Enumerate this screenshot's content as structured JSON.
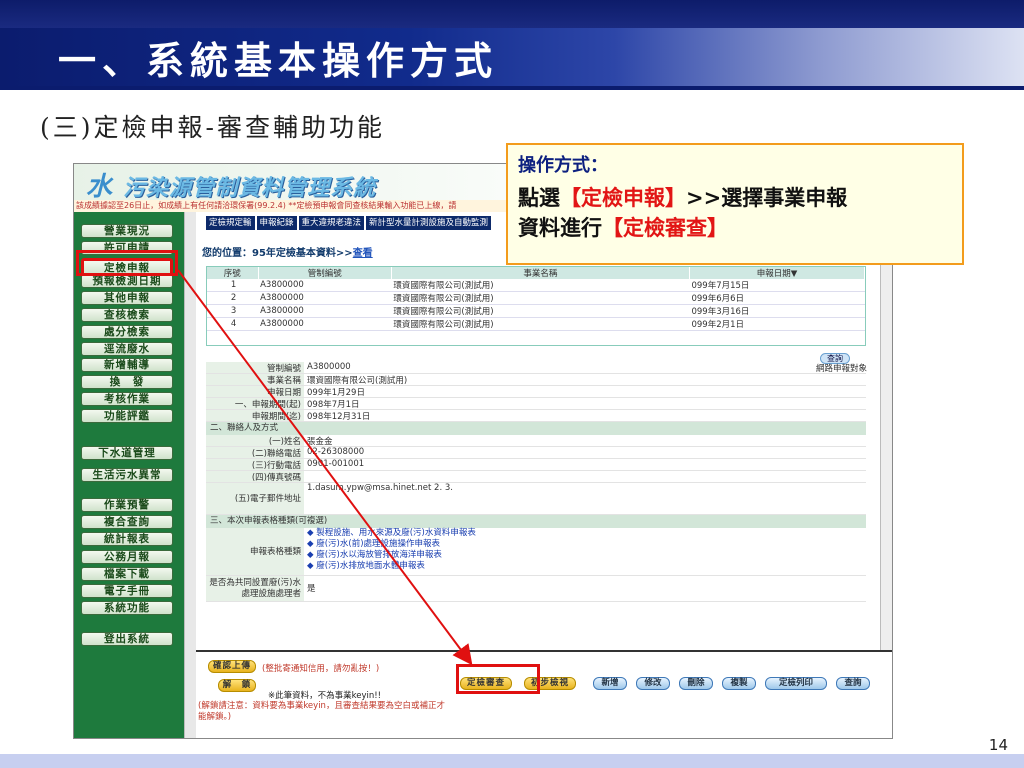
{
  "slide": {
    "title": "一、系統基本操作方式",
    "subtitle": "(三)定檢申報-審查輔助功能",
    "page_number": "14"
  },
  "app": {
    "logo_main": "污染源管制資料管理系統",
    "logo_prefix": "水",
    "ticker": "該成績據認至26日止，如成績上有任何請洽環保署(99.2.4) **定檢預申報會同查核結果輸入功能已上線，請",
    "sidebar": [
      "營業現況",
      "許可申請",
      "定檢申報",
      "預報檢測日期",
      "其他申報",
      "查核檢索",
      "處分檢索",
      "逕流廢水",
      "新增輔導",
      "換　發",
      "考核作業",
      "功能評鑑",
      "下水道管理",
      "生活污水異常",
      "作業預警",
      "複合查詢",
      "統計報表",
      "公務月報",
      "檔案下載",
      "電子手冊",
      "系統功能",
      "登出系統"
    ],
    "top_tabs": [
      "定檢規定輸",
      "申報紀錄",
      "重大違規老違法",
      "新計型水量計測設施及自動監測"
    ],
    "location_label": "您的位置：",
    "location_path": "95年定檢基本資料>>",
    "location_link": "查看",
    "grid_headers": [
      "序號",
      "管制編號",
      "事業名稱",
      "申報日期▼"
    ],
    "grid_rows": [
      [
        "1",
        "A3800000",
        "環資國際有限公司(測試用)",
        "099年7月15日"
      ],
      [
        "2",
        "A3800000",
        "環資國際有限公司(測試用)",
        "099年6月6日"
      ],
      [
        "3",
        "A3800000",
        "環資國際有限公司(測試用)",
        "099年3月16日"
      ],
      [
        "4",
        "A3800000",
        "環資國際有限公司(測試用)",
        "099年2月1日"
      ]
    ],
    "query_label": "查詢",
    "online_label": "網路申報對象",
    "form": [
      {
        "label": "管制編號",
        "value": "A3800000"
      },
      {
        "label": "事業名稱",
        "value": "環資國際有限公司(測試用)"
      },
      {
        "label": "申報日期",
        "value": "099年1月29日"
      },
      {
        "label": "一、申報期間(起)",
        "value": "098年7月1日"
      },
      {
        "label": "申報期間(迄)",
        "value": "098年12月31日"
      }
    ],
    "section2": "二、聯絡人及方式",
    "contact": [
      {
        "label": "(一)姓名",
        "value": "張金金"
      },
      {
        "label": "(二)聯絡電話",
        "value": "02-26308000"
      },
      {
        "label": "(三)行動電話",
        "value": "0901-001001"
      },
      {
        "label": "(四)傳真號碼",
        "value": ""
      },
      {
        "label": "(五)電子郵件地址",
        "value": "1.dasum.ypw@msa.hinet.net 2. 3."
      }
    ],
    "section3": "三、本次申報表格種類(可複選)",
    "form_types_label": "申報表格種類",
    "form_types": [
      "◆ 製程設施、用水來源及廢(污)水資料申報表",
      "◆ 廢(污)水(前)處理設施操作申報表",
      "◆ 廢(污)水以海放管排放海洋申報表",
      "◆ 廢(污)水排放地面水體申報表"
    ],
    "shared_label": "是否為共同設置廢(污)水處理設施處理者",
    "shared_value": "是",
    "bottom": {
      "confirm_upload": "確認上傳",
      "unlock": "解　鎖",
      "notice1": "(整批寄通知信用，請勿亂按！)",
      "notice2": "※此筆資料，不為事業keyin!!",
      "notice3": "(解鎖請注意：資料要為事業keyin，且審查結果要為空白或補正才能解鎖。)",
      "buttons": [
        "定檢審查",
        "初步檢視",
        "新增",
        "修改",
        "刪除",
        "複製",
        "定檢列印",
        "查詢"
      ]
    }
  },
  "callout": {
    "heading": "操作方式：",
    "line1_a": "點選",
    "line1_b": "【定檢申報】",
    "line1_c": ">>選擇事業申報",
    "line2_a": "資料進行",
    "line2_b": "【定檢審查】"
  }
}
